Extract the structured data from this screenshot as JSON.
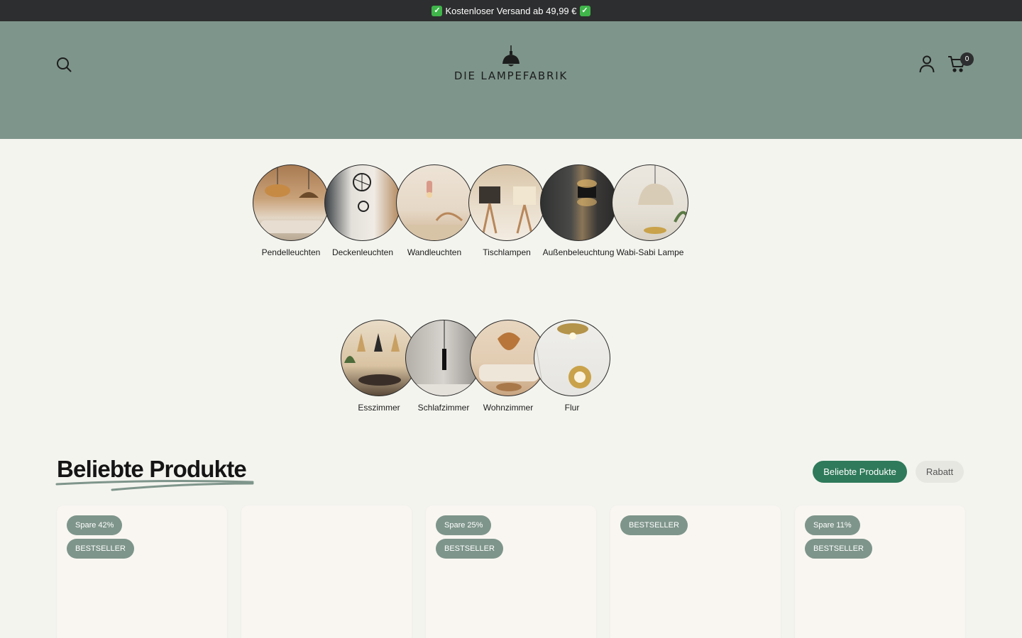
{
  "announcement": {
    "text": "Kostenloser Versand ab 49,99 €"
  },
  "header": {
    "logo_text": "DIE LAMPEFABRIK",
    "cart_count": "0",
    "background_color": "#7e958b",
    "icons": [
      "search-icon",
      "account-icon",
      "cart-icon"
    ]
  },
  "categories_row1": [
    {
      "label": "Pendelleuchten"
    },
    {
      "label": "Deckenleuchten"
    },
    {
      "label": "Wandleuchten"
    },
    {
      "label": "Tischlampen"
    },
    {
      "label": "Außenbeleuchtung"
    },
    {
      "label": "Wabi-Sabi Lampe"
    }
  ],
  "categories_row2": [
    {
      "label": "Esszimmer"
    },
    {
      "label": "Schlafzimmer"
    },
    {
      "label": "Wohnzimmer"
    },
    {
      "label": "Flur"
    }
  ],
  "section": {
    "title": "Beliebte Produkte",
    "tabs": [
      "Beliebte Produkte",
      "Rabatt"
    ],
    "accent_color": "#2e7a5a"
  },
  "products": [
    {
      "discount": "Spare 42%",
      "bestseller": "BESTSELLER"
    },
    {},
    {
      "discount": "Spare 25%",
      "bestseller": "BESTSELLER"
    },
    {
      "discount": "BESTSELLER"
    },
    {
      "discount": "Spare 11%",
      "bestseller": "BESTSELLER"
    }
  ]
}
